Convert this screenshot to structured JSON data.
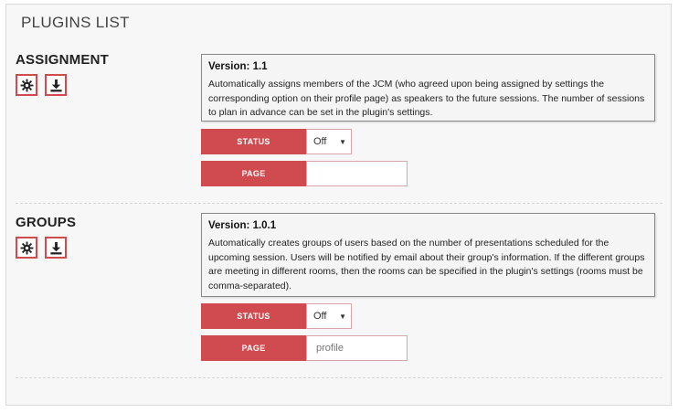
{
  "panel": {
    "title": "PLUGINS LIST"
  },
  "plugins": [
    {
      "name": "ASSIGNMENT",
      "version": "Version: 1.1",
      "description": "Automatically assigns members of the JCM (who agreed upon being assigned by settings the corresponding option on their profile page) as speakers to the future sessions. The number of sessions to plan in advance can be set in the plugin's settings.",
      "status_label": "STATUS",
      "status_value": "Off",
      "page_label": "PAGE",
      "page_value": ""
    },
    {
      "name": "GROUPS",
      "version": "Version: 1.0.1",
      "description": "Automatically creates groups of users based on the number of presentations scheduled for the upcoming session. Users will be notified by email about their group's information. If the different groups are meeting in different rooms, then the rooms can be specified in the plugin's settings (rooms must be comma-separated).",
      "status_label": "STATUS",
      "status_value": "Off",
      "page_label": "PAGE",
      "page_value": "profile"
    }
  ],
  "icons": {
    "settings": "gear-icon",
    "install": "download-icon",
    "dropdown": "caret-down-icon"
  },
  "colors": {
    "accent": "#cf4b4f",
    "panel_bg": "#f7f7f7"
  }
}
